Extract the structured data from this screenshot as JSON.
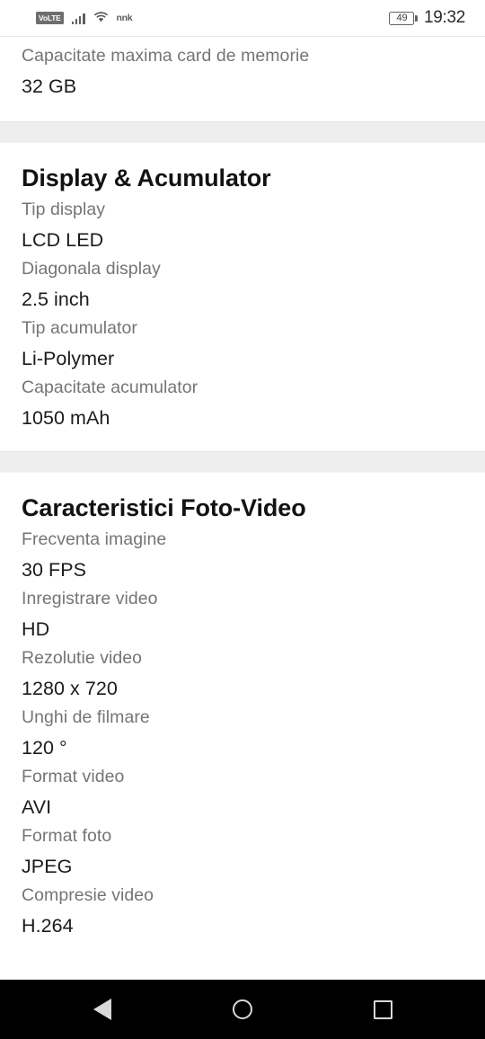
{
  "status_bar": {
    "volte_label": "VoLTE",
    "carrier_label": "nnk",
    "battery_level": "49",
    "time": "19:32",
    "icons": {
      "signal": "signal-bars-icon",
      "wifi": "wifi-icon",
      "battery": "battery-icon"
    }
  },
  "content": {
    "top_partial_row": {
      "label": "Capacitate maxima card de memorie",
      "value": "32 GB"
    },
    "sections": [
      {
        "heading": "Display & Acumulator",
        "rows": [
          {
            "label": "Tip display",
            "value": "LCD LED"
          },
          {
            "label": "Diagonala display",
            "value": "2.5 inch"
          },
          {
            "label": "Tip acumulator",
            "value": "Li-Polymer"
          },
          {
            "label": "Capacitate acumulator",
            "value": "1050 mAh"
          }
        ]
      },
      {
        "heading": "Caracteristici Foto-Video",
        "rows": [
          {
            "label": "Frecventa imagine",
            "value": "30 FPS"
          },
          {
            "label": "Inregistrare video",
            "value": "HD"
          },
          {
            "label": "Rezolutie video",
            "value": "1280 x 720"
          },
          {
            "label": "Unghi de filmare",
            "value": "120 °"
          },
          {
            "label": "Format video",
            "value": "AVI"
          },
          {
            "label": "Format foto",
            "value": "JPEG"
          },
          {
            "label": "Compresie video",
            "value": "H.264"
          }
        ]
      }
    ]
  },
  "nav_bar": {
    "back_label": "Back",
    "home_label": "Home",
    "recents_label": "Recent apps"
  },
  "colors": {
    "label_gray": "#757575",
    "value_black": "#1b1b1b",
    "band_gray": "#eeeeee",
    "nav_background": "#000000",
    "nav_icon": "#d8d8d8"
  }
}
